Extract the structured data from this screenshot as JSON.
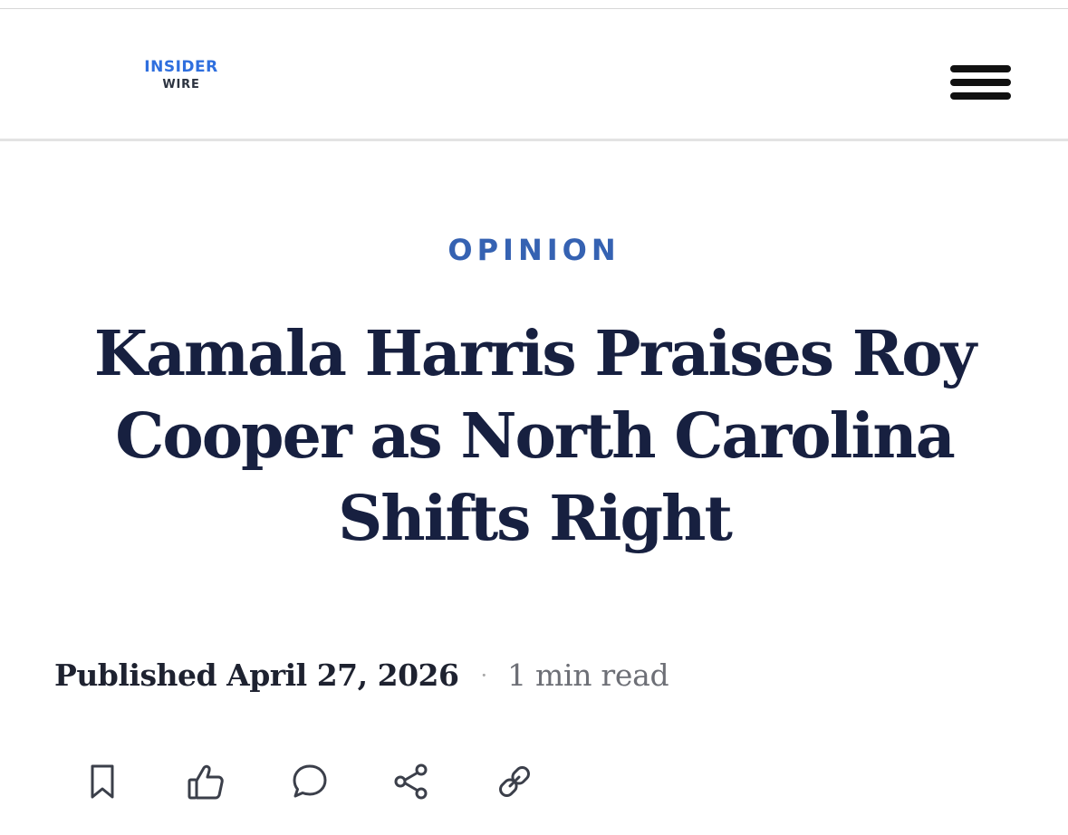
{
  "site": {
    "logo_line1": "INSIDER",
    "logo_line2": "WIRE"
  },
  "header": {
    "menu_icon": "hamburger-menu-icon"
  },
  "article": {
    "category": "OPINION",
    "headline": "Kamala Harris Praises Roy Cooper as North Carolina Shifts Right",
    "published_label": "Published April 27, 2026",
    "separator": "·",
    "read_time": "1 min read"
  },
  "actions": [
    {
      "icon": "bookmark-icon"
    },
    {
      "icon": "thumbs-up-icon"
    },
    {
      "icon": "comment-icon"
    },
    {
      "icon": "share-icon"
    },
    {
      "icon": "link-icon"
    }
  ],
  "colors": {
    "logo_accent": "#2f6fde",
    "category": "#3562b2",
    "headline": "#172040",
    "icon": "#3b3f4a"
  }
}
